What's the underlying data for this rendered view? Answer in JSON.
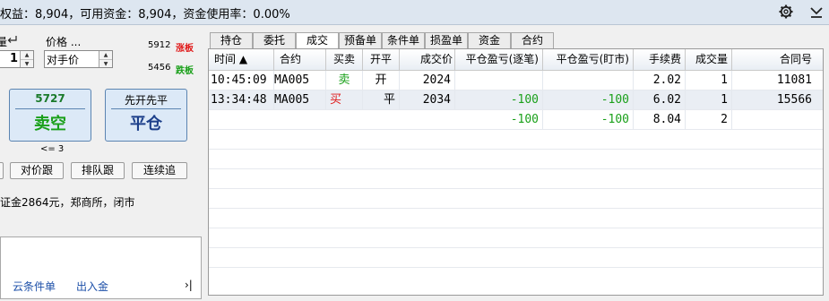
{
  "status": {
    "text": "权益：8,904，可用资金：8,904，资金使用率：0.00%"
  },
  "order": {
    "qty_label": "量",
    "qty_value": "1",
    "price_label": "价格 ...",
    "price_value": "对手价",
    "limit_up_price": "5912",
    "limit_up_label": "涨板",
    "limit_down_price": "5456",
    "limit_down_label": "跌板",
    "sell_short_price": "5727",
    "sell_short_label": "卖空",
    "close_hint": "先开先平",
    "close_label": "平仓",
    "qty_hint": "<= 3",
    "follow_buttons": [
      "对价跟",
      "排队跟",
      "连续追"
    ],
    "margin_info": "证金2864元，郑商所，闭市",
    "cloud_cond": "云条件单",
    "deposit": "出入金",
    "collapse": "›|"
  },
  "tabs": [
    "持仓",
    "委托",
    "成交",
    "预备单",
    "条件单",
    "损盈单",
    "资金",
    "合约"
  ],
  "active_tab": 2,
  "table": {
    "headers": [
      "时间 ▲",
      "合约",
      "买卖",
      "开平",
      "成交价",
      "平仓盈亏(逐笔)",
      "平仓盈亏(盯市)",
      "手续费",
      "成交量",
      "合同号"
    ],
    "rows": [
      [
        "10:45:09",
        "MA005",
        "卖",
        "开",
        "2024",
        "",
        "",
        "2.02",
        "1",
        "11081"
      ],
      [
        "13:34:48",
        "MA005",
        "买",
        "平",
        "2034",
        "-100",
        "-100",
        "6.02",
        "1",
        "15566"
      ],
      [
        "",
        "",
        "",
        "",
        "",
        "-100",
        "-100",
        "8.04",
        "2",
        ""
      ]
    ]
  },
  "colors": {
    "buy": "#e01818",
    "sell": "#1aa01a",
    "accent": "#5b84b1"
  }
}
